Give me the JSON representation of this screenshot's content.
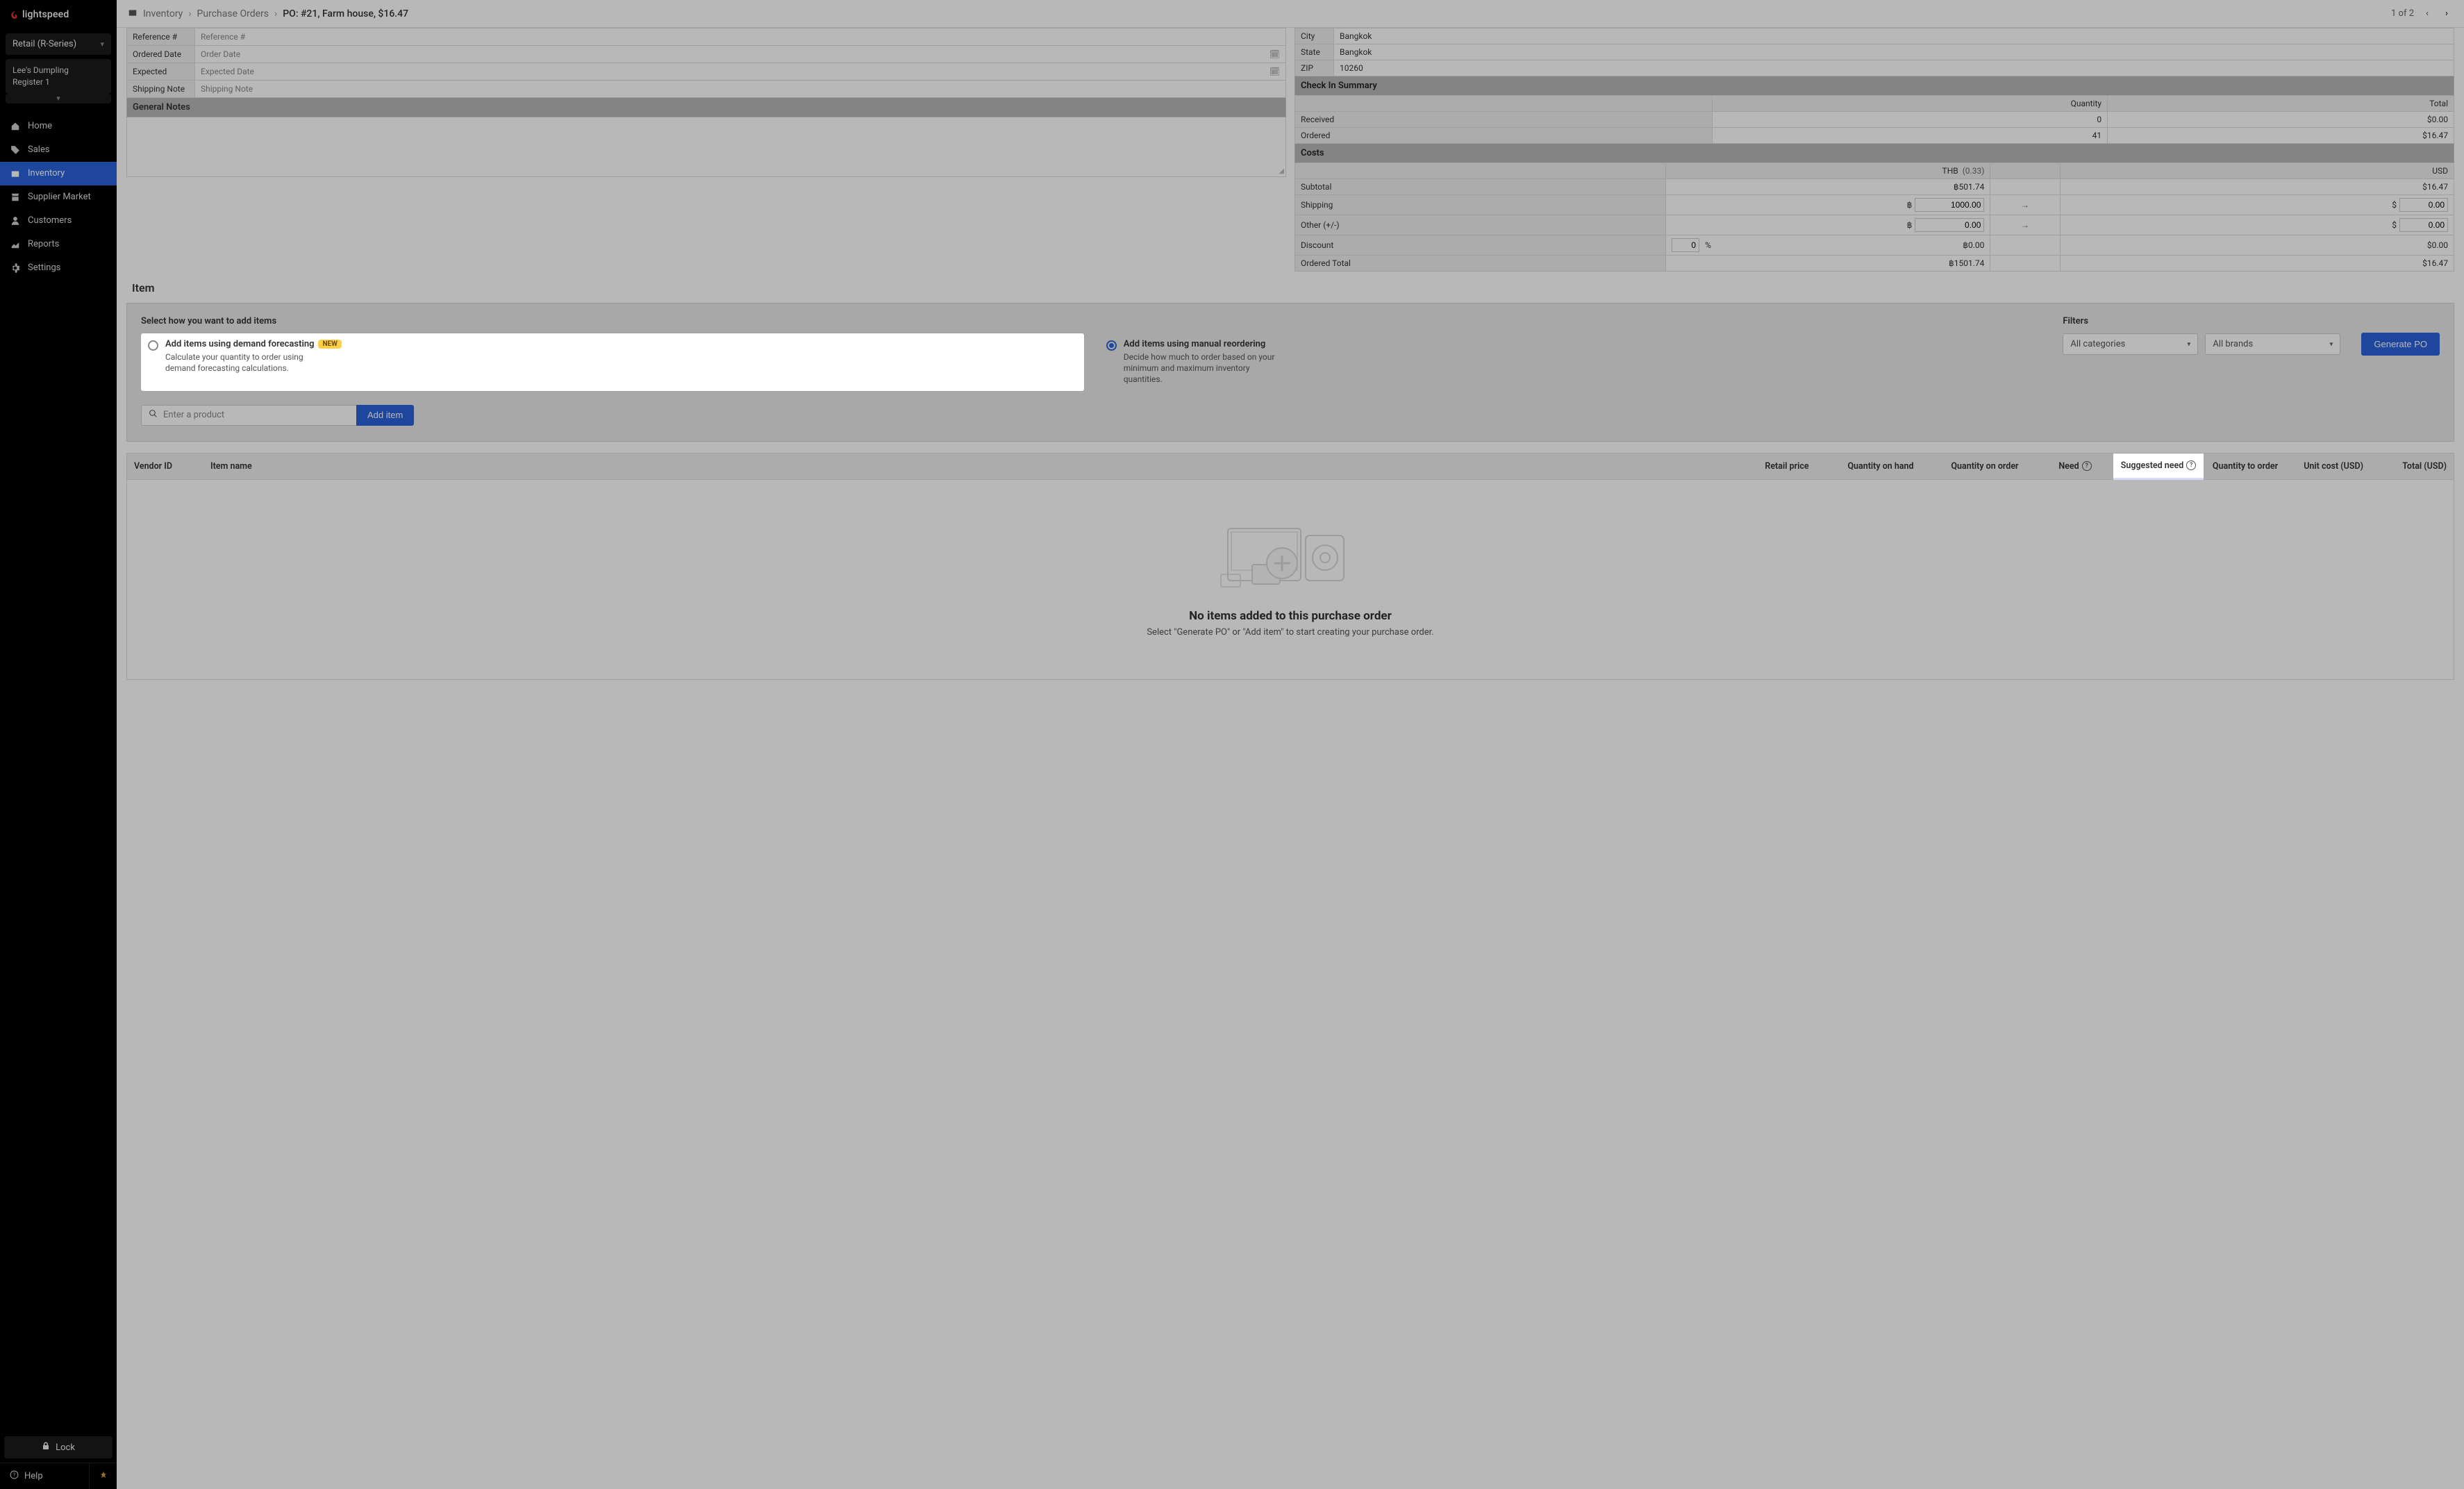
{
  "brand": "lightspeed",
  "shop": {
    "selector": "Retail (R-Series)",
    "name": "Lee's Dumpling",
    "register": "Register 1"
  },
  "nav": {
    "home": "Home",
    "sales": "Sales",
    "inventory": "Inventory",
    "supplier_market": "Supplier Market",
    "customers": "Customers",
    "reports": "Reports",
    "settings": "Settings"
  },
  "sidebar_footer": {
    "lock": "Lock",
    "help": "Help"
  },
  "breadcrumb": {
    "level1": "Inventory",
    "level2": "Purchase Orders",
    "current": "PO:  #21, Farm house, $16.47"
  },
  "pager": {
    "text": "1 of 2"
  },
  "po_form": {
    "reference_label": "Reference #",
    "reference_ph": "Reference #",
    "ordered_label": "Ordered Date",
    "ordered_ph": "Order Date",
    "expected_label": "Expected",
    "expected_ph": "Expected Date",
    "shipnote_label": "Shipping Note",
    "shipnote_ph": "Shipping Note",
    "general_notes": "General Notes"
  },
  "address": {
    "city_label": "City",
    "city": "Bangkok",
    "state_label": "State",
    "state": "Bangkok",
    "zip_label": "ZIP",
    "zip": "10260"
  },
  "checkin": {
    "title": "Check In Summary",
    "qty_label": "Quantity",
    "total_label": "Total",
    "received_label": "Received",
    "received_qty": "0",
    "received_total": "$0.00",
    "ordered_label": "Ordered",
    "ordered_qty": "41",
    "ordered_total": "$16.47"
  },
  "costs": {
    "title": "Costs",
    "thb_label": "THB",
    "rate": "(0.33)",
    "usd_label": "USD",
    "subtotal_label": "Subtotal",
    "subtotal_thb": "฿501.74",
    "subtotal_usd": "$16.47",
    "shipping_label": "Shipping",
    "shipping_thb": "1000.00",
    "shipping_usd": "0.00",
    "other_label": "Other (+/-)",
    "other_thb": "0.00",
    "other_usd": "0.00",
    "discount_label": "Discount",
    "discount_pct": "0",
    "discount_pct_sym": "%",
    "discount_thb": "฿0.00",
    "discount_usd": "$0.00",
    "ordered_total_label": "Ordered Total",
    "ordered_total_thb": "฿1501.74",
    "ordered_total_usd": "$16.47",
    "thb_sym": "฿",
    "usd_sym": "$"
  },
  "item_section": {
    "heading": "Item",
    "select_label": "Select how you want to add items",
    "opt1_title": "Add items using demand forecasting",
    "opt1_badge": "NEW",
    "opt1_desc": "Calculate your quantity to order using demand forecasting calculations.",
    "opt2_title": "Add items using manual reordering",
    "opt2_desc": "Decide how much to order based on your minimum and maximum inventory quantities.",
    "filters_label": "Filters",
    "filter_categories": "All categories",
    "filter_brands": "All brands",
    "generate_btn": "Generate PO",
    "search_ph": "Enter a product",
    "add_item_btn": "Add item"
  },
  "table": {
    "vendor_id": "Vendor ID",
    "item_name": "Item name",
    "retail_price": "Retail price",
    "qty_on_hand": "Quantity on hand",
    "qty_on_order": "Quantity on order",
    "need": "Need",
    "suggested_need": "Suggested need",
    "qty_to_order": "Quantity to order",
    "unit_cost": "Unit cost (USD)",
    "total": "Total (USD)"
  },
  "empty": {
    "title": "No items added to this purchase order",
    "sub": "Select \"Generate PO\" or \"Add item\" to start creating your purchase order."
  }
}
